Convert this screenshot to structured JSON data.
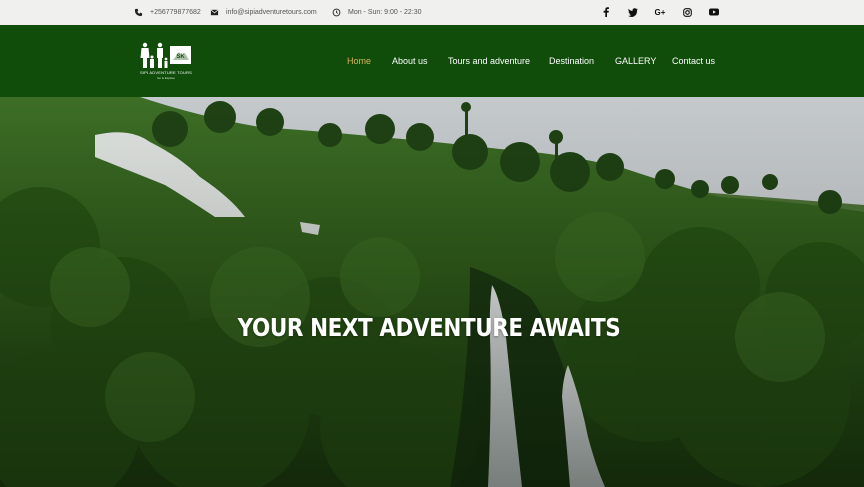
{
  "topbar": {
    "phone": "+256779877682",
    "email": "info@sipiadventuretours.com",
    "hours": "Mon - Sun: 9:00 - 22:30",
    "social": [
      "facebook-icon",
      "twitter-icon",
      "google-plus-icon",
      "instagram-icon",
      "youtube-icon"
    ]
  },
  "header": {
    "logo_text": "SIPI ADVENTURE TOURS",
    "logo_tagline": "Go & Explore",
    "logo_mark": "SK",
    "nav": [
      {
        "label": "Home",
        "active": true
      },
      {
        "label": "About us",
        "active": false
      },
      {
        "label": "Tours and adventure",
        "active": false
      },
      {
        "label": "Destination",
        "active": false
      },
      {
        "label": "GALLERY",
        "active": false
      },
      {
        "label": "Contact us",
        "active": false
      }
    ]
  },
  "hero": {
    "title": "YOUR NEXT ADVENTURE AWAITS"
  },
  "colors": {
    "header_bg": "#104d0b",
    "topbar_bg": "#f0f0ee",
    "nav_active": "#d7b55a",
    "nav_text": "#ffffff"
  }
}
